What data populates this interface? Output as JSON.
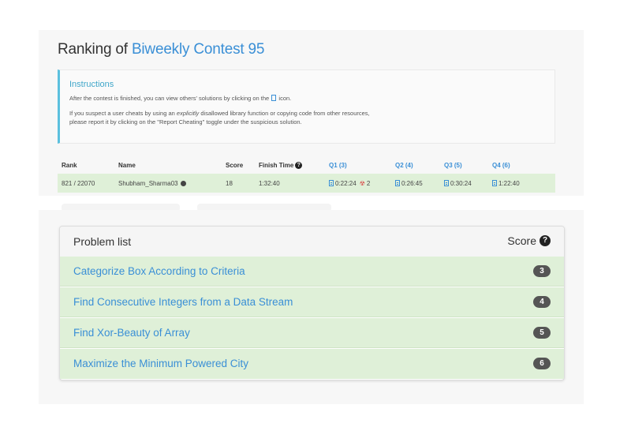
{
  "ranking": {
    "title_prefix": "Ranking of",
    "contest_name": "Biweekly Contest 95"
  },
  "instructions": {
    "heading": "Instructions",
    "line1_before": "After the contest is finished, you can view others' solutions by clicking on the",
    "line1_after": "icon.",
    "line2_before": "If you suspect a user cheats by using an",
    "line2_em": "explicitly",
    "line2_after": "disallowed library function or copying code from other resources,",
    "line3": "please report it by clicking on the \"Report Cheating\" toggle under the suspicious solution."
  },
  "table": {
    "headers": {
      "rank": "Rank",
      "name": "Name",
      "score": "Score",
      "finish_time": "Finish Time",
      "q1": "Q1 (3)",
      "q2": "Q2 (4)",
      "q3": "Q3 (5)",
      "q4": "Q4 (6)"
    },
    "row": {
      "rank": "821 / 22070",
      "name": "Shubham_Sharma03",
      "score": "18",
      "finish_time": "1:32:40",
      "q1_time": "0:22:24",
      "q1_penalty": "2",
      "q2_time": "0:26:45",
      "q3_time": "0:30:24",
      "q4_time": "1:22:40"
    }
  },
  "problem_list": {
    "header_label": "Problem list",
    "score_label": "Score",
    "items": [
      {
        "title": "Categorize Box According to Criteria",
        "score": "3"
      },
      {
        "title": "Find Consecutive Integers from a Data Stream",
        "score": "4"
      },
      {
        "title": "Find Xor-Beauty of Array",
        "score": "5"
      },
      {
        "title": "Maximize the Minimum Powered City",
        "score": "6"
      }
    ]
  },
  "colors": {
    "link_blue": "#3a8fd6",
    "success_row": "#dff0d8",
    "info_border": "#5bc0de",
    "badge_gray": "#555555"
  }
}
